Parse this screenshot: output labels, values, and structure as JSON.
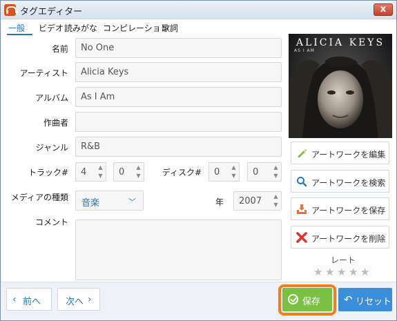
{
  "window": {
    "title": "タグエディター",
    "close_label": "x"
  },
  "tabs": [
    {
      "label": "一般",
      "active": true
    },
    {
      "label": "ビデオ",
      "active": false
    },
    {
      "label": "読みがな",
      "active": false
    },
    {
      "label": "コンピレーション",
      "active": false
    },
    {
      "label": "歌詞",
      "active": false
    }
  ],
  "form": {
    "name": {
      "label": "名前",
      "value": "No One"
    },
    "artist": {
      "label": "アーティスト",
      "value": "Alicia Keys"
    },
    "album": {
      "label": "アルバム",
      "value": "As I Am"
    },
    "composer": {
      "label": "作曲者",
      "value": ""
    },
    "genre": {
      "label": "ジャンル",
      "value": "R&B"
    },
    "track": {
      "label": "トラック#",
      "number": "4",
      "total": "0"
    },
    "disc": {
      "label": "ディスク#",
      "number": "0",
      "total": "0"
    },
    "media_type": {
      "label": "メディアの種類",
      "value": "音楽"
    },
    "year": {
      "label": "年",
      "value": "2007"
    },
    "comment": {
      "label": "コメント",
      "value": ""
    }
  },
  "artwork": {
    "cover_artist": "ALICIA KEYS",
    "cover_title": "AS I AM",
    "buttons": {
      "edit": "アートワークを編集",
      "search": "アートワークを検索",
      "save": "アートワークを保存",
      "delete": "アートワークを削除"
    }
  },
  "rating": {
    "label": "レート",
    "value": 0,
    "max": 5
  },
  "footer": {
    "prev": "前へ",
    "next": "次へ",
    "save": "保存",
    "reset": "リセット"
  },
  "colors": {
    "accent": "#2a74c4",
    "save_green": "#7ac143",
    "reset_blue": "#3a8fd8",
    "highlight_orange": "#f07f1a",
    "delete_red": "#d9352b"
  },
  "icons": {
    "edit": "pencil-icon",
    "search": "magnifier-icon",
    "save": "download-tray-icon",
    "delete": "x-icon"
  }
}
